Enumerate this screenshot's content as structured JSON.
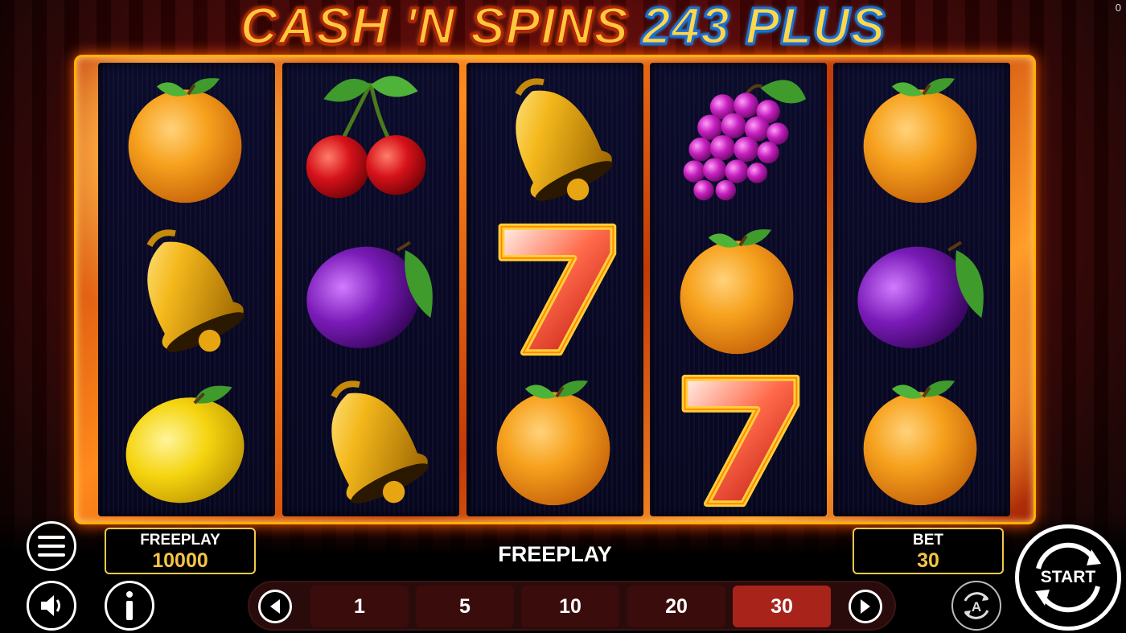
{
  "game": {
    "title_part1": "CASH 'N SPINS",
    "title_part2": "243 PLUS",
    "counter": "0"
  },
  "reels": [
    [
      "orange-icon",
      "bell-icon",
      "lemon-icon"
    ],
    [
      "cherry-icon",
      "plum-icon",
      "bell-icon"
    ],
    [
      "bell-icon",
      "seven-icon",
      "orange-icon"
    ],
    [
      "grapes-icon",
      "orange-icon",
      "seven-icon"
    ],
    [
      "orange-icon",
      "plum-icon",
      "orange-icon"
    ]
  ],
  "balance": {
    "label": "FREEPLAY",
    "value": "10000"
  },
  "status": {
    "text": "FREEPLAY"
  },
  "bet": {
    "label": "BET",
    "value": "30",
    "options": [
      "1",
      "5",
      "10",
      "20",
      "30"
    ],
    "selected": "30"
  },
  "controls": {
    "menu_icon": "hamburger-menu-icon",
    "sound_icon": "speaker-icon",
    "info_icon": "info-icon",
    "autoplay_icon": "autoplay-icon",
    "prev_icon": "left-arrow-icon",
    "next_icon": "right-arrow-icon",
    "start_label": "START"
  },
  "colors": {
    "accent_gold": "#f6c443",
    "selected_bet": "#a8231a",
    "frame_fire": "#ff8a1c"
  }
}
